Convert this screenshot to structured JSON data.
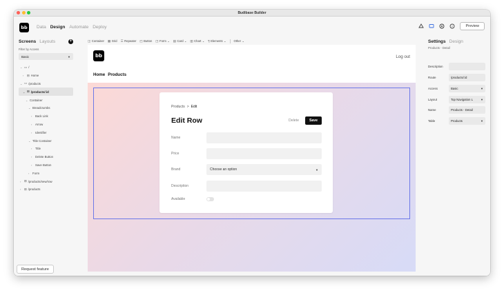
{
  "window": {
    "title": "Budibase Builder"
  },
  "app": {
    "logo_text": "bb",
    "nav": [
      "Data",
      "Design",
      "Automate",
      "Deploy"
    ],
    "preview_label": "Preview"
  },
  "left_panel": {
    "tabs": [
      "Screens",
      "Layouts"
    ],
    "add_symbol": "+",
    "filter_label": "Filter by Access",
    "filter_value": "Basic",
    "tree": [
      {
        "label": "/",
        "indent": 0,
        "chev": "⌄",
        "icon": "folder"
      },
      {
        "label": "Home",
        "indent": 1,
        "chev": "›",
        "icon": "grid"
      },
      {
        "label": "/products",
        "indent": 0,
        "chev": "⌄",
        "icon": "folder"
      },
      {
        "label": "/products/:id",
        "indent": 1,
        "chev": "⌄",
        "icon": "grid",
        "selected": true
      },
      {
        "label": "Container",
        "indent": 2,
        "chev": "⌄",
        "icon": ""
      },
      {
        "label": "Breadcrumbs",
        "indent": 3,
        "chev": "⌄",
        "icon": ""
      },
      {
        "label": "Back Link",
        "indent": 4,
        "chev": "›",
        "icon": ""
      },
      {
        "label": "Arrow",
        "indent": 4,
        "chev": "›",
        "icon": ""
      },
      {
        "label": "Identifier",
        "indent": 4,
        "chev": "›",
        "icon": ""
      },
      {
        "label": "Title Container",
        "indent": 3,
        "chev": "⌄",
        "icon": ""
      },
      {
        "label": "Title",
        "indent": 4,
        "chev": "›",
        "icon": ""
      },
      {
        "label": "Delete Button",
        "indent": 4,
        "chev": "›",
        "icon": ""
      },
      {
        "label": "Save Button",
        "indent": 4,
        "chev": "›",
        "icon": ""
      },
      {
        "label": "Form",
        "indent": 3,
        "chev": "›",
        "icon": ""
      },
      {
        "label": "/products/new/row",
        "indent": 0,
        "chev": "›",
        "icon": "grid"
      },
      {
        "label": "/products",
        "indent": 0,
        "chev": "›",
        "icon": "grid"
      }
    ],
    "request_feature_label": "Request feature"
  },
  "toolbar": {
    "items": [
      {
        "icon": "◫",
        "label": "Container"
      },
      {
        "icon": "▦",
        "label": "Grid"
      },
      {
        "icon": "☰",
        "label": "Repeater"
      },
      {
        "icon": "◰",
        "label": "Button"
      },
      {
        "icon": "◳",
        "label": "Form",
        "dropdown": true
      },
      {
        "icon": "▤",
        "label": "Card",
        "dropdown": true
      },
      {
        "icon": "▥",
        "label": "Chart",
        "dropdown": true
      },
      {
        "icon": "¶",
        "label": "Elements",
        "dropdown": true
      },
      {
        "icon": "",
        "label": "Other",
        "dropdown": true
      }
    ]
  },
  "canvas": {
    "logo_text": "bb",
    "logout_label": "Log out",
    "nav_links": [
      "Home",
      "Products"
    ],
    "card": {
      "crumb_parent": "Products",
      "crumb_sep": ">",
      "crumb_current": "Edit",
      "title": "Edit Row",
      "delete_label": "Delete",
      "save_label": "Save",
      "fields": [
        {
          "label": "Name",
          "type": "text",
          "value": ""
        },
        {
          "label": "Price",
          "type": "text",
          "value": ""
        },
        {
          "label": "Brand",
          "type": "select",
          "value": "Choose an option"
        },
        {
          "label": "Description",
          "type": "text",
          "value": ""
        },
        {
          "label": "Available",
          "type": "toggle",
          "value": ""
        }
      ]
    }
  },
  "right_panel": {
    "tabs": [
      "Settings",
      "Design"
    ],
    "subtitle": "Products - Detail",
    "props": [
      {
        "label": "Description",
        "value": "",
        "dropdown": false
      },
      {
        "label": "Route",
        "value": "/products/:id",
        "dropdown": false
      },
      {
        "label": "Access",
        "value": "Basic",
        "dropdown": true
      },
      {
        "label": "Layout",
        "value": "Top Navigation L",
        "dropdown": true
      },
      {
        "label": "Name",
        "value": "Products - Detail",
        "dropdown": false
      },
      {
        "label": "Table",
        "value": "Products",
        "dropdown": true
      }
    ]
  },
  "colors": {
    "accent_outline": "#6c78e8",
    "save_button": "#111111",
    "gradient_start": "#fcd9d6",
    "gradient_end": "#d7dbf7"
  }
}
